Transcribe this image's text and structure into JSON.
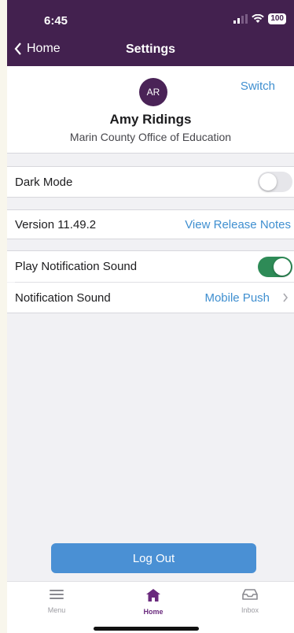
{
  "status": {
    "time": "6:45",
    "battery": "100"
  },
  "nav": {
    "back_label": "Home",
    "title": "Settings"
  },
  "profile": {
    "initials": "AR",
    "switch_label": "Switch",
    "name": "Amy Ridings",
    "organization": "Marin County Office of Education"
  },
  "settings": {
    "dark_mode_label": "Dark Mode",
    "dark_mode_on": false,
    "version_label": "Version 11.49.2",
    "release_notes_label": "View Release Notes",
    "play_sound_label": "Play Notification Sound",
    "play_sound_on": true,
    "notification_sound_label": "Notification Sound",
    "notification_sound_value": "Mobile Push"
  },
  "logout_label": "Log Out",
  "tabs": [
    {
      "label": "Menu",
      "icon": "menu-icon",
      "active": false
    },
    {
      "label": "Home",
      "icon": "home-icon",
      "active": true
    },
    {
      "label": "Inbox",
      "icon": "inbox-icon",
      "active": false
    }
  ],
  "colors": {
    "header": "#43214f",
    "accent_link": "#3f8fd0",
    "toggle_on": "#2e8b57",
    "logout_button": "#4a90d4",
    "active_tab": "#6a2a7d"
  }
}
